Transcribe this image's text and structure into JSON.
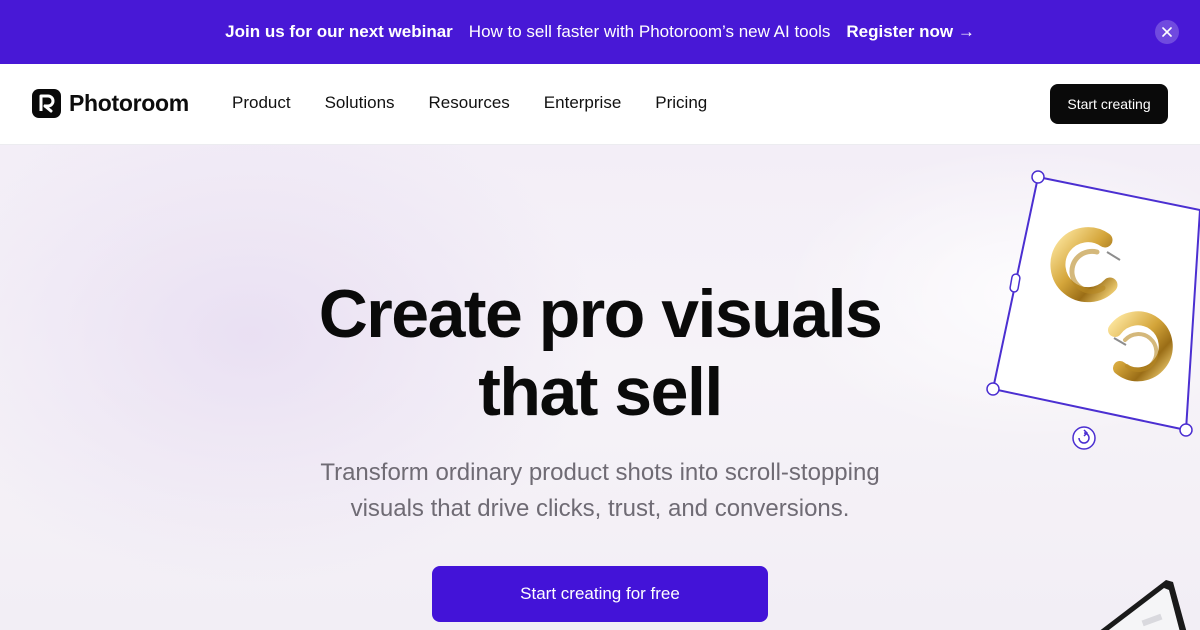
{
  "banner": {
    "lead": "Join us for our next webinar",
    "sub": "How to sell faster with Photoroom’s new AI tools",
    "cta": "Register now →"
  },
  "header": {
    "brand": "Photoroom",
    "nav": [
      "Product",
      "Solutions",
      "Resources",
      "Enterprise",
      "Pricing"
    ],
    "cta": "Start creating"
  },
  "hero": {
    "headline_line1": "Create pro visuals",
    "headline_line2": "that sell",
    "subhead_line1": "Transform ordinary product shots into scroll-stopping",
    "subhead_line2": "visuals that drive clicks, trust, and conversions.",
    "cta": "Start creating for free"
  },
  "colors": {
    "banner_bg": "#4818d6",
    "primary": "#4313d8",
    "header_cta_bg": "#0a0a0a",
    "selection_frame": "#4b2fd1",
    "subhead_text": "#6f6b74"
  },
  "icons": [
    "close-icon",
    "photoroom-logo-icon",
    "rotate-icon",
    "selection-handle-icon"
  ]
}
